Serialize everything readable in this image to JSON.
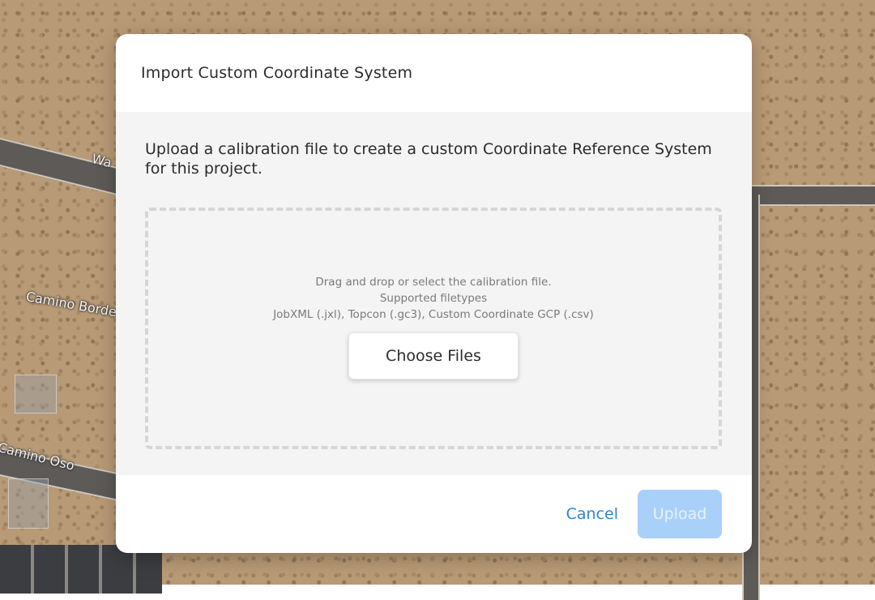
{
  "map": {
    "labels": {
      "camino_border": "Camino Borde",
      "camino_oso": "Camino Oso",
      "was": "Wa"
    }
  },
  "dialog": {
    "title": "Import Custom Coordinate System",
    "description": "Upload a calibration file to create a custom Coordinate Reference System for this project.",
    "dropzone": {
      "hint_line1": "Drag and drop or select the calibration file.",
      "hint_line2": "Supported filetypes",
      "hint_line3": "JobXML (.jxl), Topcon (.gc3), Custom Coordinate GCP (.csv)",
      "choose_label": "Choose Files"
    },
    "footer": {
      "cancel_label": "Cancel",
      "upload_label": "Upload",
      "upload_disabled": true
    }
  },
  "colors": {
    "accent": "#2b86d9",
    "upload_disabled_bg": "#a9d0f8",
    "body_bg": "#f4f4f4"
  }
}
